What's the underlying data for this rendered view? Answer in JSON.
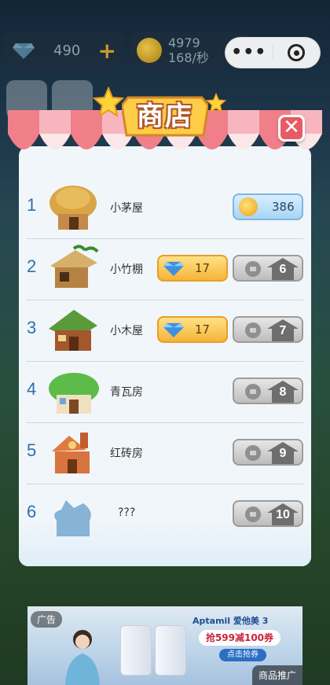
{
  "hud": {
    "gems": "490",
    "coins": "4979",
    "coin_rate": "168/秒",
    "plus_label": "+"
  },
  "capsule": {
    "more_label": "•••"
  },
  "shop": {
    "title": "商店",
    "close_label": "✕",
    "items": [
      {
        "index": "1",
        "name": "小茅屋",
        "price_type": "coin",
        "price": "386"
      },
      {
        "index": "2",
        "name": "小竹棚",
        "price_type": "gem",
        "price": "17",
        "unlock_level": "6"
      },
      {
        "index": "3",
        "name": "小木屋",
        "price_type": "gem",
        "price": "17",
        "unlock_level": "7"
      },
      {
        "index": "4",
        "name": "青瓦房",
        "price_type": "locked",
        "unlock_level": "8"
      },
      {
        "index": "5",
        "name": "红砖房",
        "price_type": "locked",
        "unlock_level": "9"
      },
      {
        "index": "6",
        "name": "???",
        "price_type": "locked",
        "unlock_level": "10"
      }
    ]
  },
  "ad": {
    "tag": "广告",
    "brand": "Aptamil 爱他美 3",
    "price_text": "抢599减100券",
    "cta": "点击抢券",
    "promo_label": "商品推广"
  },
  "colors": {
    "accent_blue": "#2f6fae",
    "close_red": "#e85a64",
    "awning_red": "#f07f8a",
    "gem_button": "#f6b43a",
    "coin_button": "#a8d4f5"
  }
}
